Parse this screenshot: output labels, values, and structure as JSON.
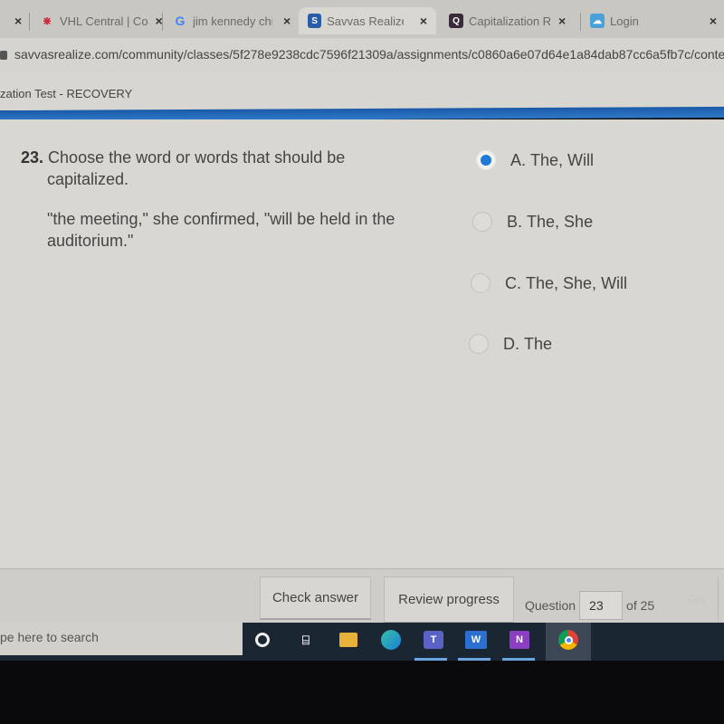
{
  "browser": {
    "tabs": [
      {
        "label": "",
        "close": "×"
      },
      {
        "label": "VHL Central | Co",
        "icon": "vhl-logo-icon",
        "close": "×"
      },
      {
        "label": "jim kennedy chil",
        "icon": "google-icon",
        "close": "×"
      },
      {
        "label": "Savvas Realize",
        "icon": "savvas-icon",
        "close": "×",
        "active": true
      },
      {
        "label": "Capitalization R",
        "icon": "quizlet-icon",
        "close": "×"
      },
      {
        "label": "Login",
        "icon": "cloud-icon",
        "close": "×"
      }
    ],
    "url": "savvasrealize.com/community/classes/5f278e9238cdc7596f21309a/assignments/c0860a6e07d64e1a84dab87cc6a5fb7c/conte"
  },
  "page": {
    "title": "zation Test - RECOVERY",
    "accent_color": "#1e6cc0"
  },
  "question": {
    "number": "23.",
    "text_line1": "Choose the word or words that should be",
    "text_line2": "capitalized.",
    "prompt_line1": "\"the meeting,\" she confirmed, \"will be held in the",
    "prompt_line2": "auditorium.\"",
    "options": [
      {
        "letter": "A.",
        "text": "The, Will",
        "selected": true
      },
      {
        "letter": "B.",
        "text": "The, She",
        "selected": false
      },
      {
        "letter": "C.",
        "text": "The, She, Will",
        "selected": false
      },
      {
        "letter": "D.",
        "text": "The",
        "selected": false
      }
    ]
  },
  "toolbar": {
    "check_answer": "Check answer",
    "review_progress": "Review progress",
    "question_label": "Question",
    "question_value": "23",
    "of_total": "of 25",
    "go": "Go"
  },
  "taskbar": {
    "search_placeholder": "pe here to search",
    "apps": [
      "cortana",
      "task-view",
      "file-explorer",
      "edge",
      "teams",
      "word",
      "onenote",
      "chrome"
    ]
  }
}
